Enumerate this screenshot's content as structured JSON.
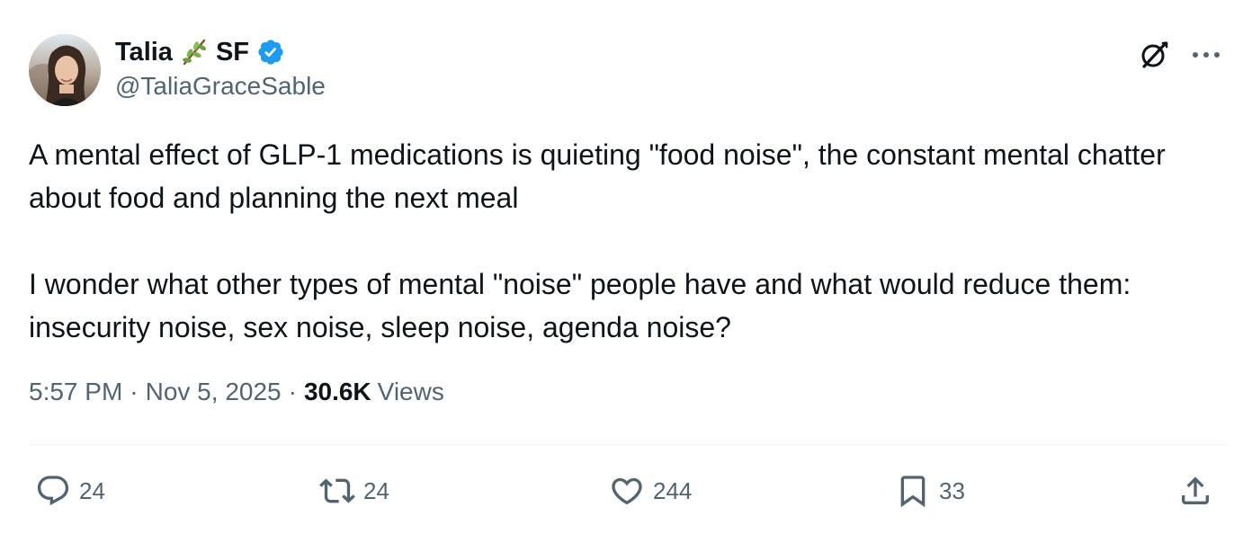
{
  "author": {
    "display_name": "Talia",
    "display_name_suffix": "SF",
    "handle": "@TaliaGraceSable",
    "verified": true
  },
  "icons": {
    "name_emoji": "leaf-branch-icon",
    "verified": "verified-badge-icon",
    "grok": "grok-icon",
    "more": "more-icon",
    "reply": "reply-icon",
    "repost": "repost-icon",
    "like": "like-icon",
    "bookmark": "bookmark-icon",
    "share": "share-icon"
  },
  "tweet": {
    "text": "A mental effect of GLP-1 medications is quieting \"food noise\", the constant mental chatter about food and planning the next meal\n\nI wonder what other types of mental \"noise\" people have and what would reduce them: insecurity noise, sex noise, sleep noise, agenda noise?"
  },
  "meta": {
    "time": "5:57 PM",
    "separator": "·",
    "date": "Nov 5, 2025",
    "views_count": "30.6K",
    "views_label": "Views"
  },
  "actions": {
    "replies": "24",
    "reposts": "24",
    "likes": "244",
    "bookmarks": "33"
  },
  "colors": {
    "text_primary": "#0f1419",
    "text_secondary": "#536471",
    "verified_blue": "#1d9bf0",
    "divider": "#eff3f4"
  }
}
